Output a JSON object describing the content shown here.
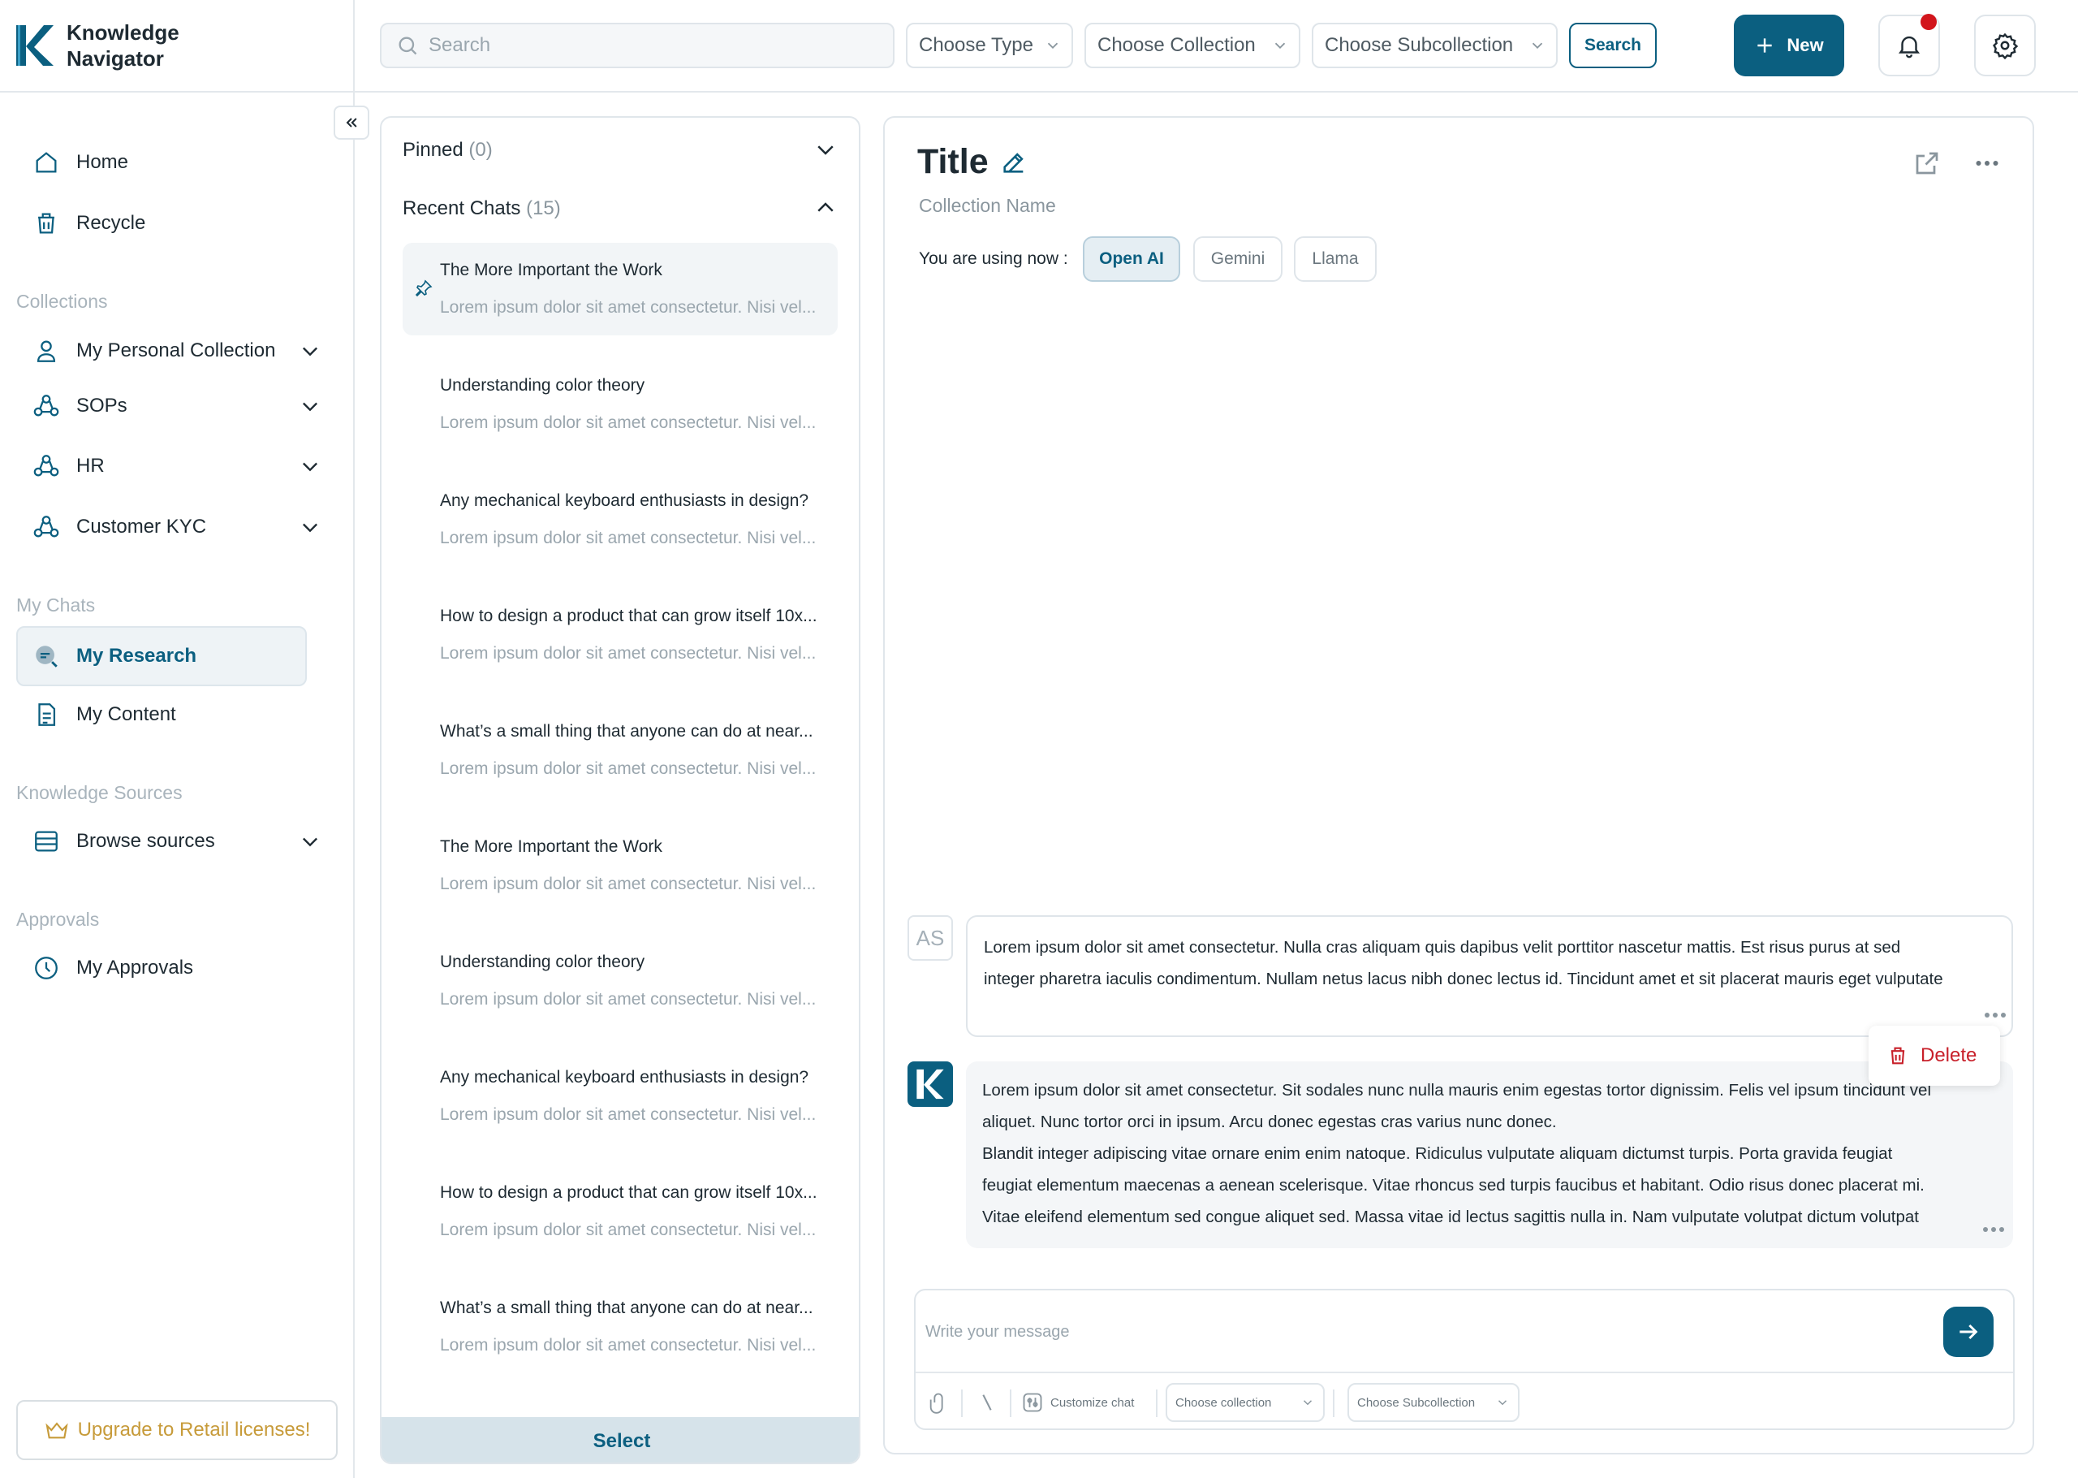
{
  "app": {
    "name": "Knowledge Navigator"
  },
  "sidebar": {
    "home": "Home",
    "recycle": "Recycle",
    "collections_label": "Collections",
    "collections": [
      {
        "label": "My Personal Collection",
        "icon": "user-icon"
      },
      {
        "label": "SOPs",
        "icon": "group-icon"
      },
      {
        "label": "HR",
        "icon": "group-icon"
      },
      {
        "label": "Customer KYC",
        "icon": "group-icon"
      }
    ],
    "my_chats_label": "My Chats",
    "my_research": "My Research",
    "my_content": "My Content",
    "knowledge_sources_label": "Knowledge Sources",
    "browse_sources": "Browse sources",
    "approvals_label": "Approvals",
    "my_approvals": "My Approvals",
    "upgrade": "Upgrade to Retail licenses!"
  },
  "topbar": {
    "search_placeholder": "Search",
    "choose_type": "Choose Type",
    "choose_collection": "Choose Collection",
    "choose_subcollection": "Choose Subcollection",
    "search_button": "Search",
    "new_button": "New"
  },
  "chat_list": {
    "pinned_label": "Pinned",
    "pinned_count": "(0)",
    "recent_label": "Recent Chats",
    "recent_count": "(15)",
    "items": [
      {
        "title": "The More Important the Work",
        "preview": "Lorem ipsum dolor sit amet consectetur. Nisi vel..."
      },
      {
        "title": "Understanding color theory",
        "preview": "Lorem ipsum dolor sit amet consectetur. Nisi vel..."
      },
      {
        "title": "Any mechanical keyboard enthusiasts in design?",
        "preview": "Lorem ipsum dolor sit amet consectetur. Nisi vel..."
      },
      {
        "title": "How to design a product that can grow itself 10x...",
        "preview": "Lorem ipsum dolor sit amet consectetur. Nisi vel..."
      },
      {
        "title": "What’s a small thing that anyone can do at near...",
        "preview": "Lorem ipsum dolor sit amet consectetur. Nisi vel..."
      },
      {
        "title": "The More Important the Work",
        "preview": "Lorem ipsum dolor sit amet consectetur. Nisi vel..."
      },
      {
        "title": "Understanding color theory",
        "preview": "Lorem ipsum dolor sit amet consectetur. Nisi vel..."
      },
      {
        "title": "Any mechanical keyboard enthusiasts in design?",
        "preview": "Lorem ipsum dolor sit amet consectetur. Nisi vel..."
      },
      {
        "title": "How to design a product that can grow itself 10x...",
        "preview": "Lorem ipsum dolor sit amet consectetur. Nisi vel..."
      },
      {
        "title": "What’s a small thing that anyone can do at near...",
        "preview": "Lorem ipsum dolor sit amet consectetur. Nisi vel..."
      }
    ],
    "select_button": "Select"
  },
  "chat": {
    "title": "Title",
    "collection_name": "Collection Name",
    "using_label": "You are using now :",
    "models": [
      "Open AI",
      "Gemini",
      "Llama"
    ],
    "active_model": "Open AI",
    "user_initials": "AS",
    "user_message": [
      "Lorem ipsum dolor sit amet consectetur. Nulla cras aliquam quis dapibus velit porttitor nascetur mattis. Est risus purus at sed",
      "integer pharetra iaculis condimentum. Nullam netus lacus nibh donec lectus id. Tincidunt amet et sit placerat mauris eget vulputate"
    ],
    "bot_message": [
      "Lorem ipsum dolor sit amet consectetur. Sit sodales nunc nulla mauris enim egestas tortor dignissim. Felis vel ipsum tincidunt vel",
      "aliquet. Nunc tortor orci in ipsum. Arcu donec egestas cras varius nunc donec.",
      "Blandit integer adipiscing vitae ornare enim enim natoque. Ridiculus vulputate aliquam dictumst turpis. Porta gravida feugiat",
      "feugiat elementum maecenas a aenean scelerisque. Vitae rhoncus sed turpis faucibus et habitant. Odio risus donec placerat mi.",
      "Vitae eleifend elementum sed congue aliquet sed. Massa vitae id lectus sagittis nulla in. Nam vulputate volutpat dictum volutpat"
    ],
    "delete_label": "Delete",
    "composer_placeholder": "Write your message",
    "customize_chat": "Customize chat",
    "choose_collection": "Choose collection",
    "choose_subcollection": "Choose Subcollection"
  },
  "colors": {
    "brand": "#0b5f80",
    "danger": "#c8202a",
    "notification": "#d2151c",
    "upgrade": "#c79b3a"
  }
}
